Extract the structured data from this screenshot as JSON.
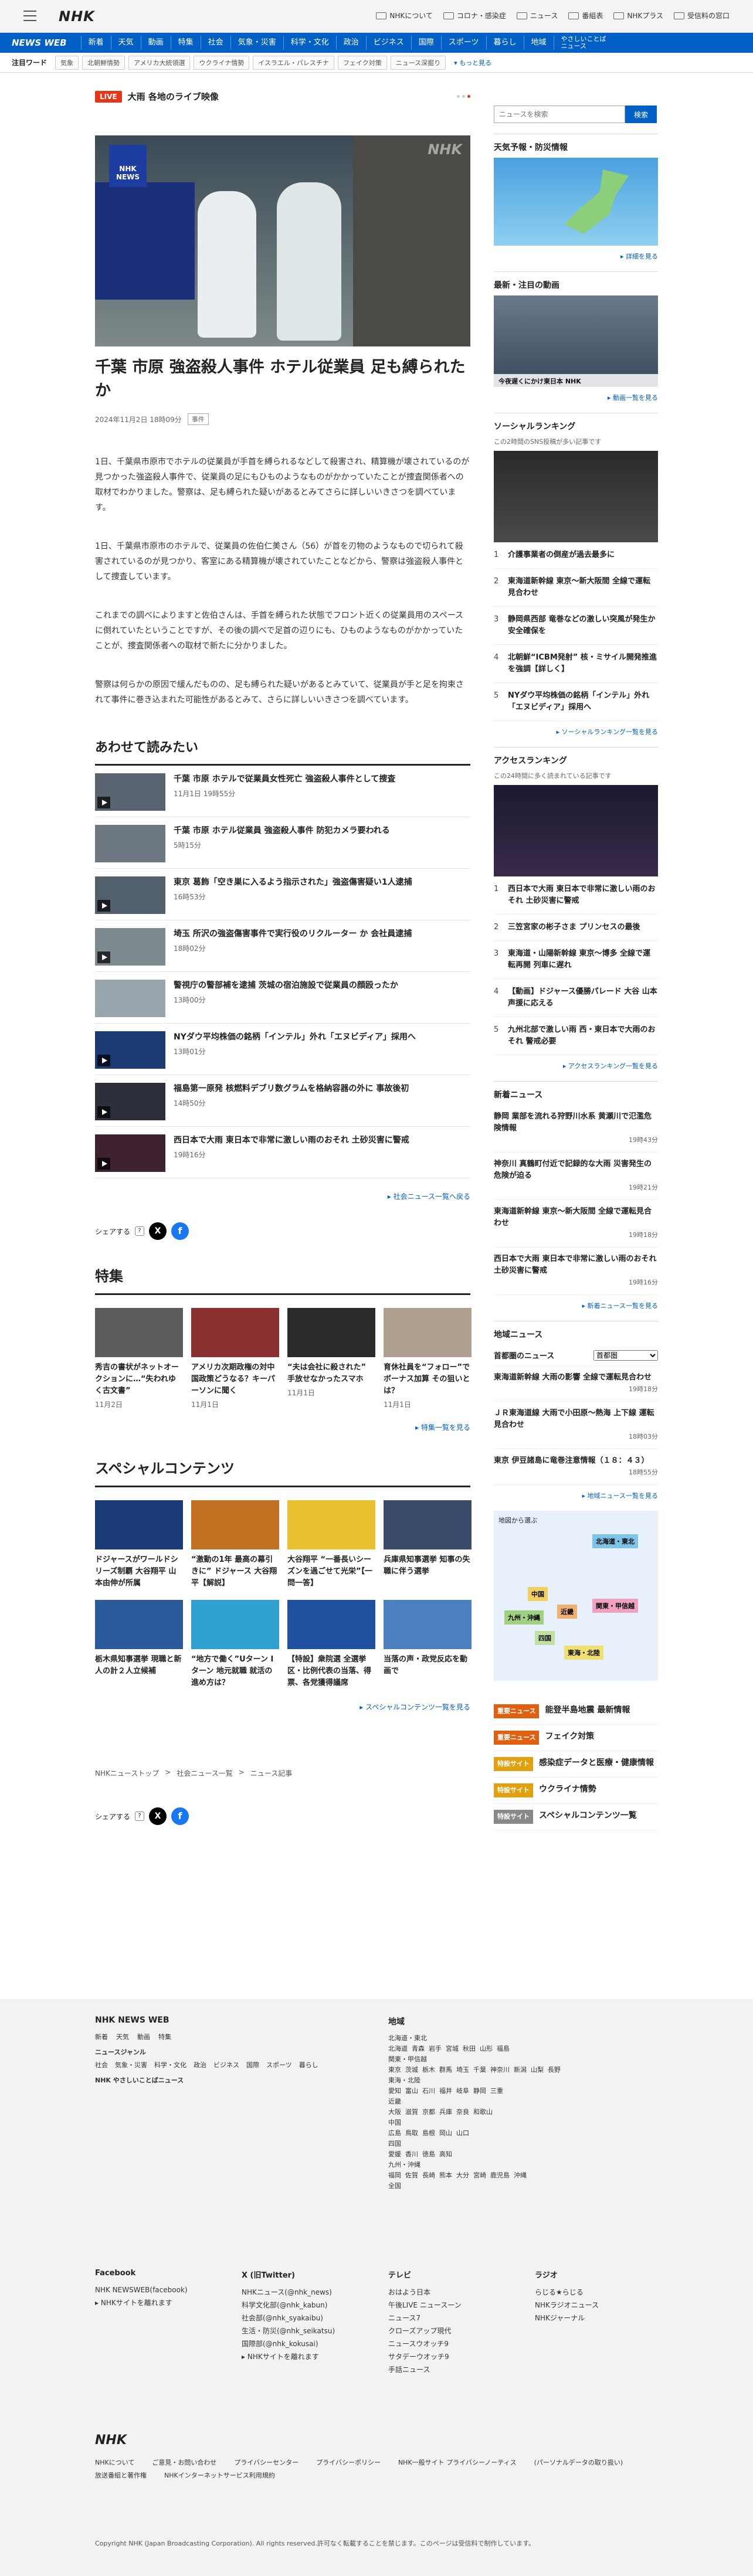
{
  "header": {
    "logo": "NHK",
    "links": [
      {
        "label": "NHKについて",
        "icon": "info-icon"
      },
      {
        "label": "コロナ・感染症",
        "icon": "virus-icon"
      },
      {
        "label": "ニュース",
        "icon": "news-icon"
      },
      {
        "label": "番組表",
        "icon": "tv-icon"
      },
      {
        "label": "NHKプラス",
        "icon": "plus-icon"
      },
      {
        "label": "受信料の窓口",
        "icon": "receipt-icon"
      }
    ]
  },
  "nav": {
    "brand": "NEWS WEB",
    "items": [
      "新着",
      "天気",
      "動画",
      "特集",
      "社会",
      "気象・災害",
      "科学・文化",
      "政治",
      "ビジネス",
      "国際",
      "スポーツ",
      "暮らし",
      "地域",
      "やさしいことば\nニュース"
    ]
  },
  "keywords": {
    "label": "注目ワード",
    "items": [
      "気象",
      "北朝鮮情勢",
      "アメリカ大統領選",
      "ウクライナ情勢",
      "イスラエル・パレスチナ",
      "フェイク対策",
      "ニュース深掘り"
    ],
    "more": "もっと見る"
  },
  "live": {
    "badge": "LIVE",
    "title": "大雨 各地のライブ映像"
  },
  "article": {
    "hero_badge": "NHK\nNEWS",
    "hero_watermark": "NHK",
    "title": "千葉 市原 強盗殺人事件 ホテル従業員 足も縛られたか",
    "datetime": "2024年11月2日 18時09分",
    "category": "事件",
    "paragraphs": [
      "1日、千葉県市原市でホテルの従業員が手首を縛られるなどして殺害され、精算機が壊されているのが見つかった強盗殺人事件で、従業員の足にもひものようなものがかかっていたことが捜査関係者への取材でわかりました。警察は、足も縛られた疑いがあるとみてさらに詳しいいきさつを調べています。",
      "1日、千葉県市原市のホテルで、従業員の佐伯仁美さん（56）が首を刃物のようなもので切られて殺害されているのが見つかり、客室にある精算機が壊されていたことなどから、警察は強盗殺人事件として捜査しています。",
      "これまでの調べによりますと佐伯さんは、手首を縛られた状態でフロント近くの従業員用のスペースに倒れていたということですが、その後の調べで足首の辺りにも、ひものようなものがかかっていたことが、捜査関係者への取材で新たに分かりました。",
      "警察は何らかの原因で緩んだものの、足も縛られた疑いがあるとみていて、従業員が手と足を拘束されて事件に巻き込まれた可能性があるとみて、さらに詳しいいきさつを調べています。"
    ]
  },
  "related": {
    "heading": "あわせて読みたい",
    "items": [
      {
        "title": "千葉 市原 ホテルで従業員女性死亡 強盗殺人事件として捜査",
        "date": "11月1日 19時55分",
        "video": true,
        "color": "#5a6470"
      },
      {
        "title": "千葉 市原 ホテル従業員 強盗殺人事件 防犯カメラ要われる",
        "date": "5時15分",
        "video": false,
        "color": "#6d7880"
      },
      {
        "title": "東京 葛飾「空き巣に入るよう指示された」強盗傷害疑い1人逮捕",
        "date": "16時53分",
        "video": true,
        "color": "#52606b"
      },
      {
        "title": "埼玉 所沢の強盗傷害事件で実行役のリクルーター か 会社員逮捕",
        "date": "18時02分",
        "video": true,
        "color": "#7c8a90"
      },
      {
        "title": "警視庁の警部補を逮捕 茨城の宿泊施設で従業員の顔殴ったか",
        "date": "13時00分",
        "video": false,
        "color": "#9aa6ad"
      },
      {
        "title": "NYダウ平均株価の銘柄「インテル」外れ「エヌビディア」採用へ",
        "date": "13時01分",
        "video": true,
        "color": "#1d3b73"
      },
      {
        "title": "福島第一原発 核燃料デブリ数グラムを格納容器の外に 事故後初",
        "date": "14時50分",
        "video": true,
        "color": "#2d2f3a"
      },
      {
        "title": "西日本で大雨 東日本で非常に激しい雨のおそれ 土砂災害に警戒",
        "date": "19時16分",
        "video": true,
        "color": "#3e2230"
      }
    ],
    "more": "社会ニュース一覧へ戻る"
  },
  "share": {
    "label": "シェアする",
    "q": "?",
    "x": "X",
    "f": "f"
  },
  "tokushu": {
    "heading": "特集",
    "items": [
      {
        "title": "秀吉の書状がネットオークションに…“失われゆく古文書”",
        "date": "11月2日",
        "color": "#5c5d5a"
      },
      {
        "title": "アメリカ次期政権の対中国政策どうなる？キーパーソンに聞く",
        "date": "11月1日",
        "color": "#8a3030"
      },
      {
        "title": "“夫は会社に殺された” 手放せなかったスマホ",
        "date": "11月1日",
        "color": "#2a2a2a"
      },
      {
        "title": "育休社員を“フォロー”でボーナス加算 その狙いとは？",
        "date": "11月1日",
        "color": "#b0a090"
      }
    ],
    "more": "特集一覧を見る"
  },
  "special": {
    "heading": "スペシャルコンテンツ",
    "items": [
      {
        "title": "ドジャースがワールドシリーズ制覇 大谷翔平 山本由伸が所属",
        "color": "#1a3a78"
      },
      {
        "title": "“激動の1年 最高の幕引きに” ドジャース 大谷翔平【解説】",
        "color": "#c07020"
      },
      {
        "title": "大谷翔平 “一番長いシーズンを過ごせて光栄”【一問一答】",
        "color": "#e8c030"
      },
      {
        "title": "兵庫県知事選挙 知事の失職に伴う選挙",
        "color": "#3a4a6a"
      },
      {
        "title": "栃木県知事選挙 現職と新人の計２人立候補",
        "color": "#2a5a9a"
      },
      {
        "title": "“地方で働く”Uターン Iターン 地元就職 就活の進め方は？",
        "color": "#30a0d0"
      },
      {
        "title": "【特設】衆院選 全選挙区・比例代表の当落、得票、各党獲得議席",
        "color": "#2050a0"
      },
      {
        "title": "当落の声・政党反応を動画で",
        "color": "#4a80c0"
      }
    ],
    "more": "スペシャルコンテンツ一覧を見る"
  },
  "sidebar": {
    "search_placeholder": "ニュースを検索",
    "search_button": "検索",
    "weather_heading": "天気予報・防災情報",
    "weather_more": "詳細を見る",
    "video_heading": "最新・注目の動画",
    "video_caption": "今夜遅くにかけ東日本 NHK",
    "video_more": "動画一覧を見る",
    "social_heading": "ソーシャルランキング",
    "social_sub": "この2時間のSNS投稿が多い記事です",
    "social_items": [
      "介護事業者の倒産が過去最多に",
      "東海道新幹線 東京～新大阪間 全線で運転見合わせ",
      "静岡県西部 竜巻などの激しい突風が発生か 安全確保を",
      "北朝鮮“ICBM発射” 核・ミサイル開発推進を強調【詳しく】",
      "NYダウ平均株価の銘柄「インテル」外れ「エヌビディア」採用へ"
    ],
    "social_more": "ソーシャルランキング一覧を見る",
    "access_heading": "アクセスランキング",
    "access_sub": "この24時間に多く読まれている記事です",
    "access_items": [
      "西日本で大雨 東日本で非常に激しい雨のおそれ 土砂災害に警戒",
      "三笠宮家の彬子さま プリンセスの最後",
      "東海道・山陽新幹線 東京～博多 全線で運転再開 列車に遅れ",
      "【動画】ドジャース優勝パレード 大谷 山本 声援に応える",
      "九州北部で激しい雨 西・東日本で大雨のおそれ 警戒必要"
    ],
    "access_more": "アクセスランキング一覧を見る",
    "new_heading": "新着ニュース",
    "new_items": [
      {
        "title": "静岡 業部を流れる狩野川水系 黄瀬川で氾濫危険情報",
        "date": "19時43分"
      },
      {
        "title": "神奈川 真鶴町付近で記録的な大雨 災害発生の危険が迫る",
        "date": "19時21分"
      },
      {
        "title": "東海道新幹線 東京～新大阪間 全線で運転見合わせ",
        "date": "19時18分"
      },
      {
        "title": "西日本で大雨 東日本で非常に激しい雨のおそれ 土砂災害に警戒",
        "date": "19時16分"
      }
    ],
    "new_more": "新着ニュース一覧を見る",
    "region_heading": "地域ニュース",
    "region_label": "首都圏のニュース",
    "region_select": "首都圏",
    "region_items": [
      {
        "title": "東海道新幹線 大雨の影響 全線で運転見合わせ",
        "date": "19時18分"
      },
      {
        "title": "ＪＲ東海道線 大雨で小田原～熱海 上下線 運転見合わせ",
        "date": "18時03分"
      },
      {
        "title": "東京 伊豆諸島に竜巻注意情報（１８：４３）",
        "date": "18時55分"
      }
    ],
    "region_more": "地域ニュース一覧を見る",
    "map_title": "地図から選ぶ",
    "map_regions": [
      "北海道・東北",
      "中国",
      "近畿",
      "関東・甲信越",
      "九州・沖縄",
      "四国",
      "東海・北陸"
    ],
    "tags": [
      {
        "label": "重要ニュース",
        "color": "#e06010",
        "title": "能登半島地震 最新情報"
      },
      {
        "label": "重要ニュース",
        "color": "#e06010",
        "title": "フェイク対策"
      },
      {
        "label": "特設サイト",
        "color": "#e0a010",
        "title": "感染症データと医療・健康情報"
      },
      {
        "label": "特設サイト",
        "color": "#e0a010",
        "title": "ウクライナ情勢"
      },
      {
        "label": "特設サイト",
        "color": "#888888",
        "title": "スペシャルコンテンツ一覧"
      }
    ]
  },
  "breadcrumb": [
    "NHKニューストップ",
    "社会ニュース一覧",
    "ニュース記事"
  ],
  "footer": {
    "brand": "NHK NEWS WEB",
    "col1": [
      "新着",
      "天気",
      "動画",
      "特集"
    ],
    "genre_label": "ニュースジャンル",
    "genres": [
      "社会",
      "気象・災害",
      "科学・文化",
      "政治",
      "ビジネス",
      "国際",
      "スポーツ",
      "暮らし"
    ],
    "easy": "NHK やさしいことばニュース",
    "region_label": "地域",
    "regions": [
      "北海道・東北",
      "北海道  青森  岩手  宮城  秋田  山形  福島",
      "関東・甲信越",
      "東京  茨城  栃木  群馬  埼玉  千葉  神奈川  新潟  山梨  長野",
      "東海・北陸",
      "愛知  富山  石川  福井  岐阜  静岡  三重",
      "近畿",
      "大阪  滋賀  京都  兵庫  奈良  和歌山",
      "中国",
      "広島  鳥取  島根  岡山  山口",
      "四国",
      "愛媛  香川  徳島  高知",
      "九州・沖縄",
      "福岡  佐賀  長崎  熊本  大分  宮崎  鹿児島  沖縄",
      "全国"
    ],
    "fb_label": "Facebook",
    "fb_items": [
      "NHK NEWSWEB(facebook)",
      "▸ NHKサイトを離れます"
    ],
    "x_label": "X (旧Twitter)",
    "x_items": [
      "NHKニュース(@nhk_news)",
      "科学文化部(@nhk_kabun)",
      "社会部(@nhk_syakaibu)",
      "生活・防災(@nhk_seikatsu)",
      "国際部(@nhk_kokusai)",
      "▸ NHKサイトを離れます"
    ],
    "tv_label": "テレビ",
    "tv_items": [
      "おはよう日本",
      "午後LIVE ニュースーン",
      "ニュース7",
      "クローズアップ現代",
      "ニュースウオッチ9",
      "サタデーウオッチ9",
      "手話ニュース"
    ],
    "radio_label": "ラジオ",
    "radio_items": [
      "らじる★らじる",
      "NHKラジオニュース",
      "NHKジャーナル"
    ],
    "logo": "NHK",
    "bottom_links": [
      "NHKについて",
      "ご意見・お問い合わせ",
      "プライバシーセンター",
      "プライバシーポリシー",
      "NHK一般サイト プライバシーノーティス",
      "(パーソナルデータの取り扱い)",
      "放送番組と著作権",
      "NHKインターネットサービス利用規約"
    ],
    "copyright": "Copyright NHK (Japan Broadcasting Corporation). All rights reserved.許可なく転載することを禁じます。このページは受信料で制作しています。"
  }
}
